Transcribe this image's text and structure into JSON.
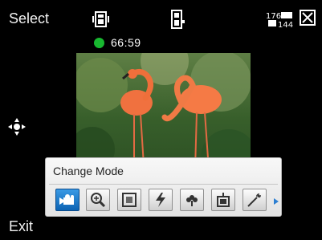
{
  "softkeys": {
    "left": "Select",
    "bottom_left": "Exit"
  },
  "status_bar": {
    "resolution_top": "176",
    "resolution_bottom": "144"
  },
  "recording": {
    "elapsed": "66:59",
    "status_color": "#18b830"
  },
  "mode_panel": {
    "title": "Change Mode",
    "modes": [
      {
        "icon": "video-camera-icon",
        "active": true
      },
      {
        "icon": "zoom-icon",
        "active": false
      },
      {
        "icon": "frame-icon",
        "active": false
      },
      {
        "icon": "flash-icon",
        "active": false
      },
      {
        "icon": "macro-flower-icon",
        "active": false
      },
      {
        "icon": "light-frame-icon",
        "active": false
      },
      {
        "icon": "effects-icon",
        "active": false
      }
    ],
    "accent_color": "#0c63b3"
  }
}
